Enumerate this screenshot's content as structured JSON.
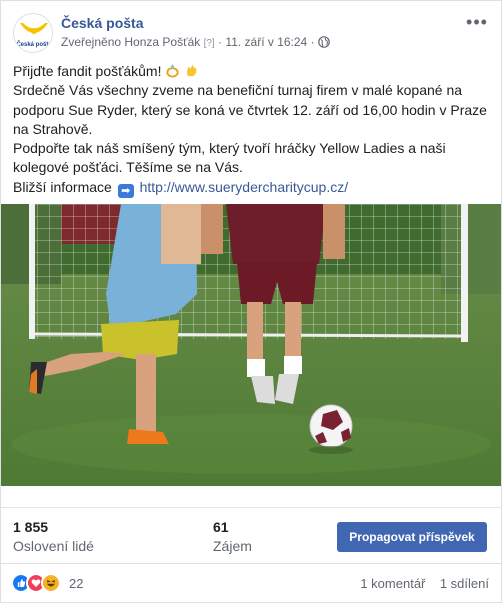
{
  "header": {
    "page_name": "Česká pošta",
    "published_by": "Zveřejněno Honza Pošťák",
    "help_marker": "[?]",
    "separator": "·",
    "timestamp": "11. září v 16:24",
    "logo_text": "Česká pošta"
  },
  "post": {
    "line1": "Přijďte fandit pošťákům!",
    "line2": "Srdečně Vás všechny zveme na benefiční turnaj firem v malé kopané na",
    "line3": "podporu Sue Ryder, který se koná ve čtvrtek 12. září od 16,00 hodin v Praze",
    "line4": "na Strahově.",
    "line5": "Podpořte tak náš smíšený tým, který tvoří hráčky Yellow Ladies a naši",
    "line6": "kolegové pošťáci. Těšíme se na Vás.",
    "info_label": "Bližší informace",
    "arrow_glyph": "➡",
    "link": "http://www.suerydercharitycup.cz/"
  },
  "stats": {
    "reach_value": "1 855",
    "reach_label": "Oslovení lidé",
    "engagement_value": "61",
    "engagement_label": "Zájem",
    "promote_label": "Propagovat příspěvek"
  },
  "reactions": {
    "count": "22",
    "comments": "1 komentář",
    "shares": "1 sdílení",
    "icons": [
      "like-icon",
      "love-icon",
      "haha-icon"
    ]
  },
  "colors": {
    "link": "#385898",
    "button": "#4267b2",
    "brand_yellow": "#f5c400",
    "brand_blue": "#1c3f94"
  }
}
